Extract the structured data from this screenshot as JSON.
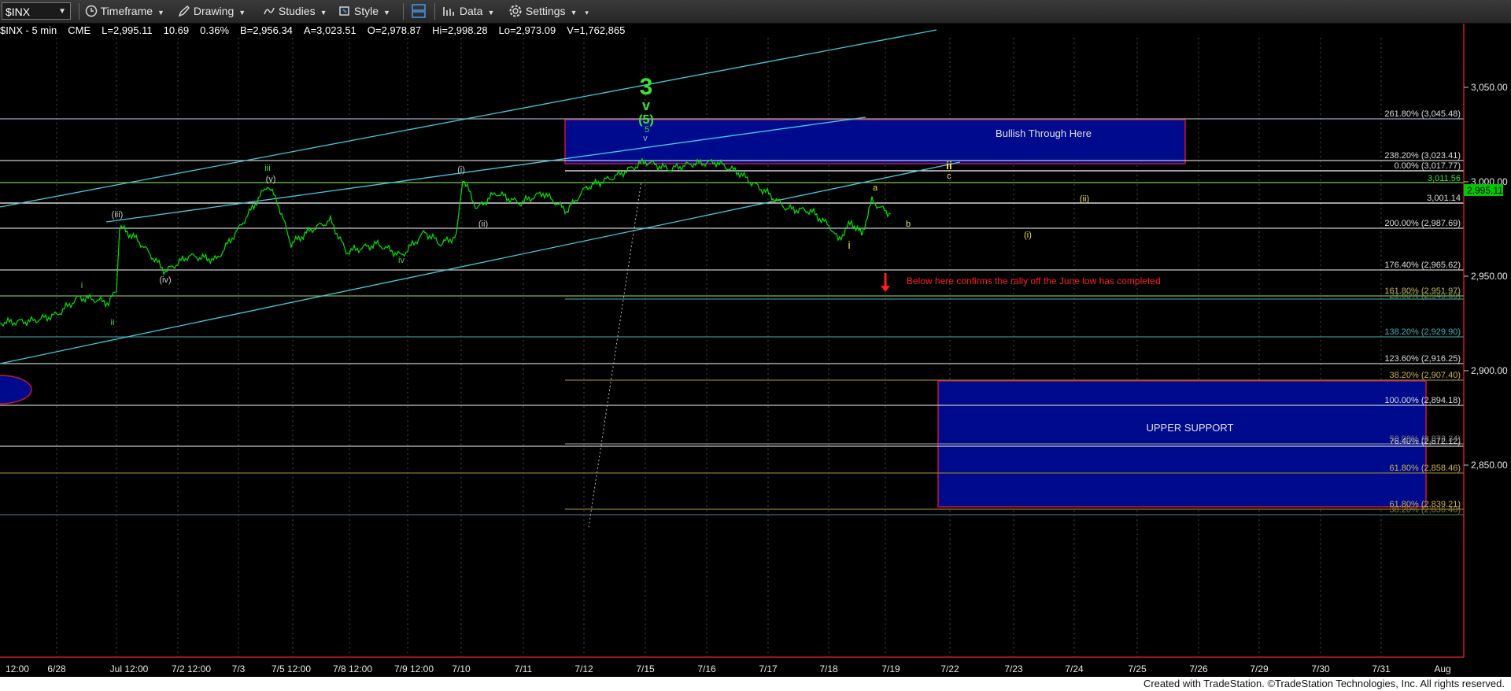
{
  "toolbar": {
    "symbol": "$INX",
    "timeframe": "Timeframe",
    "drawing": "Drawing",
    "studies": "Studies",
    "style": "Style",
    "data": "Data",
    "settings": "Settings"
  },
  "status": {
    "name": "$INX - 5 min",
    "exchange": "CME",
    "last": "L=2,995.11",
    "change": "10.69",
    "pct": "0.36%",
    "bid": "B=2,956.34",
    "ask": "A=3,023.51",
    "open": "O=2,978.87",
    "high": "Hi=2,998.28",
    "low": "Lo=2,973.09",
    "volume": "V=1,762,865"
  },
  "colors": {
    "price": "#00e400",
    "channel": "#46c8dc",
    "zone": "#000a8c",
    "zone_border": "#c8143c",
    "warn": "#ff1e1e",
    "yellow": "#e8e43c",
    "tan": "#b0a050"
  },
  "price_axis": {
    "ticks": [
      "3,050.00",
      "3,000.00",
      "2,950.00",
      "2,900.00",
      "2,850.00"
    ],
    "current": "2,995.11"
  },
  "time_axis": [
    "12:00",
    "6/28",
    "Jul 12:00",
    "7/2 12:00",
    "7/3",
    "7/5 12:00",
    "7/8 12:00",
    "7/9 12:00",
    "7/10",
    "7/11",
    "7/12",
    "7/15",
    "7/16",
    "7/17",
    "7/18",
    "7/19",
    "7/22",
    "7/23",
    "7/24",
    "7/25",
    "7/26",
    "7/29",
    "7/30",
    "7/31",
    "Aug"
  ],
  "zones": {
    "upper": "Bullish Through Here",
    "lower": "UPPER SUPPORT"
  },
  "note": "Below here confirms the rally off the June low has completed",
  "fib_levels": [
    "261.80% (3,045.48)",
    "238.20% (3,023.41)",
    "0.00% (3,017.77)",
    "3,011.56",
    "3,001.14",
    "200.00% (2,987.69)",
    "176.40% (2,965.62)",
    "161.80% (2,951.97)",
    "23.60% (2,949.59)",
    "138.20% (2,929.90)",
    "123.60% (2,916.25)",
    "38.20% (2,907.40)",
    "100.00% (2,894.18)",
    "76.40% (2,872.12)",
    "50.00% (2,872.34)",
    "61.80% (2,858.46)",
    "61.80% (2,839.21)",
    "38.20% (2,836.40)"
  ],
  "wave_labels": {
    "w3": "3",
    "w_v": "v",
    "w5p": "(5)",
    "w5": "5",
    "w_v_small": "v",
    "iii_green": "iii",
    "v_paren": "(v)",
    "iii_paren": "(iii)",
    "iv_paren": "(iv)",
    "iv_green": "iv",
    "i_paren": "(i)",
    "ii_paren": "(ii)",
    "i_green": "i",
    "ii_green": "ii",
    "a": "a",
    "b": "b",
    "c": "c",
    "ii_yellow": "ii",
    "i_yellow": "i",
    "ii_p_yellow": "(ii)",
    "i_p_yellow": "(i)"
  },
  "footer": "Created with TradeStation. ©TradeStation Technologies, Inc. All rights reserved."
}
